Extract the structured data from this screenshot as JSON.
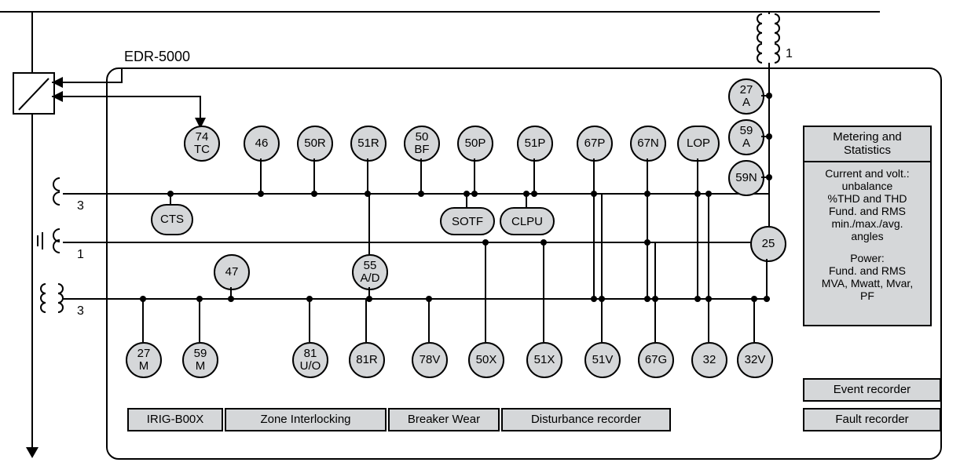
{
  "title": "EDR-5000",
  "bus_labels": {
    "ct1": "3",
    "ct2": "1",
    "vt": "3",
    "pt_right": "1"
  },
  "elements": {
    "row1": [
      "74\nTC",
      "46",
      "50R",
      "51R",
      "50\nBF",
      "50P",
      "51P",
      "67P",
      "67N",
      "LOP"
    ],
    "right_col": [
      "27\nA",
      "59\nA",
      "59N",
      "25"
    ],
    "mid_left": "CTS",
    "mid_pills": [
      "SOTF",
      "CLPU"
    ],
    "mid_47": "47",
    "mid_55": "55\nA/D",
    "row3": [
      "27\nM",
      "59\nM",
      "81\nU/O",
      "81R",
      "78V",
      "50X",
      "51X",
      "51V",
      "67G",
      "32",
      "32V"
    ]
  },
  "buttons": {
    "irig": "IRIG-B00X",
    "zone": "Zone Interlocking",
    "bw": "Breaker Wear",
    "dist": "Disturbance recorder",
    "event": "Event recorder",
    "fault": "Fault recorder"
  },
  "panel": {
    "head": "Metering and\nStatistics",
    "body1": "Current and volt.:\nunbalance\n%THD and THD\nFund. and RMS\nmin./max./avg.\nangles",
    "body2": "Power:\nFund. and RMS\nMVA, Mwatt, Mvar,\nPF"
  }
}
